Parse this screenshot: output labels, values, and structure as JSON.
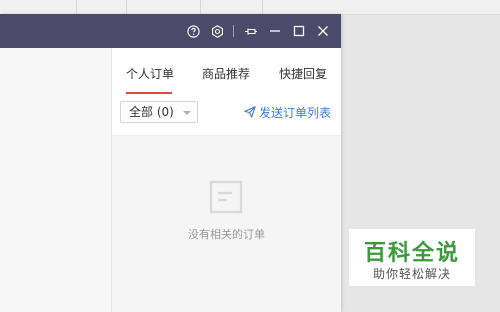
{
  "window": {
    "tabs": [
      {
        "label": "个人订单",
        "active": true
      },
      {
        "label": "商品推荐",
        "active": false
      },
      {
        "label": "快捷回复",
        "active": false
      }
    ],
    "filter": {
      "selected": "全部 (0)"
    },
    "send_order_list": "发送订单列表",
    "empty_message": "没有相关的订单"
  },
  "titlebar_icons": [
    "help-icon",
    "settings-icon",
    "pin-icon",
    "minimize-icon",
    "maximize-icon",
    "close-icon"
  ],
  "watermark": {
    "title": "百科全说",
    "subtitle": "助你轻松解决"
  },
  "colors": {
    "titlebar": "#4b4a6b",
    "active_tab_underline": "#e54545",
    "link": "#3d7ed6",
    "watermark_green": "#3c9a3c"
  }
}
